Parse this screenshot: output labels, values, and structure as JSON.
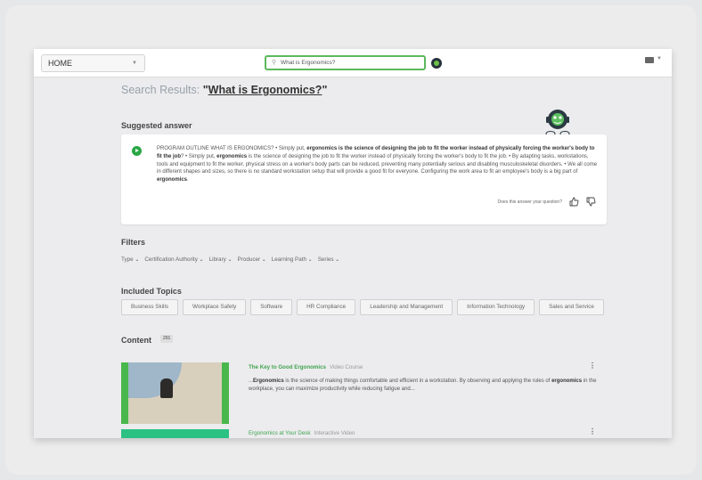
{
  "topbar": {
    "home_label": "HOME",
    "search_value": "What is Ergonomics?"
  },
  "results": {
    "prefix": "Search Results: ",
    "query": "What is Ergonomics?"
  },
  "suggested": {
    "heading": "Suggested answer",
    "text_html": "PROGRAM OUTLINE WHAT IS ERGONOMICS? • Simply put, <b>ergonomics is the science of designing the job to fit the worker instead of physically forcing the worker's body to fit the job</b>? • Simply put, <b>ergonomics</b> is the science of designing the job to fit the worker instead of physically forcing the worker's body to fit the job. • By adapting tasks, workstations, tools and equipment to fit the worker, physical stress on a worker's body parts can be reduced, preventing many potentially serious and disabling musculoskeletal disorders. • We all come in different shapes and sizes, so there is no standard workstation setup that will provide a good fit for everyone. Configuring the work area to fit an employee's body is a big part of <b>ergonomics</b>.",
    "feedback_question": "Does this answer your question?"
  },
  "filters": {
    "heading": "Filters",
    "items": [
      "Type",
      "Certification Authority",
      "Library",
      "Producer",
      "Learning Path",
      "Series"
    ]
  },
  "topics": {
    "heading": "Included Topics",
    "items": [
      "Business Skills",
      "Workplace Safety",
      "Software",
      "HR Compliance",
      "Leadership and Management",
      "Information Technology",
      "Sales and Service"
    ]
  },
  "content": {
    "heading": "Content",
    "count": "291",
    "items": [
      {
        "title": "The Key to Good Ergonomics",
        "kind": "Video Course",
        "snippet_html": "...<b>Ergonomics</b> is the science of making things comfortable and efficient in a workstation. By observing and applying the rules of <b>ergonomics</b> in the workplace, you can maximize productivity while reducing fatigue and..."
      },
      {
        "title": "Ergonomics at Your Desk",
        "kind": "Interactive Video"
      }
    ]
  },
  "colors": {
    "accent_green": "#3fa34d",
    "search_border": "#5cb85c"
  }
}
